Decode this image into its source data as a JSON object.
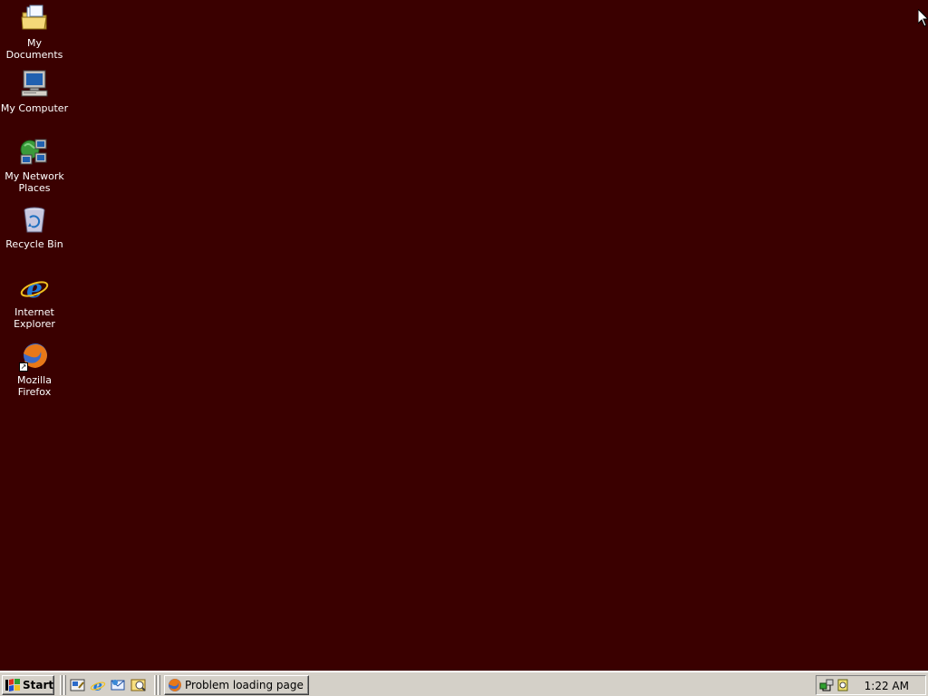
{
  "desktop": {
    "background_color": "#3a0000",
    "icons": [
      {
        "label": "My Documents",
        "icon": "folder-documents-icon"
      },
      {
        "label": "My Computer",
        "icon": "computer-icon"
      },
      {
        "label": "My Network Places",
        "icon": "network-icon"
      },
      {
        "label": "Recycle Bin",
        "icon": "recycle-bin-icon"
      },
      {
        "label": "Internet Explorer",
        "icon": "ie-icon"
      },
      {
        "label": "Mozilla Firefox",
        "icon": "firefox-icon"
      }
    ]
  },
  "taskbar": {
    "start_label": "Start",
    "quick_launch": [
      "show-desktop-icon",
      "ie-icon",
      "outlook-icon",
      "media-icon"
    ],
    "tasks": [
      {
        "label": "Problem loading page ...",
        "icon": "firefox-icon"
      }
    ],
    "tray_icons": [
      "network-tray-icon",
      "volume-tray-icon"
    ],
    "clock": "1:22 AM"
  }
}
